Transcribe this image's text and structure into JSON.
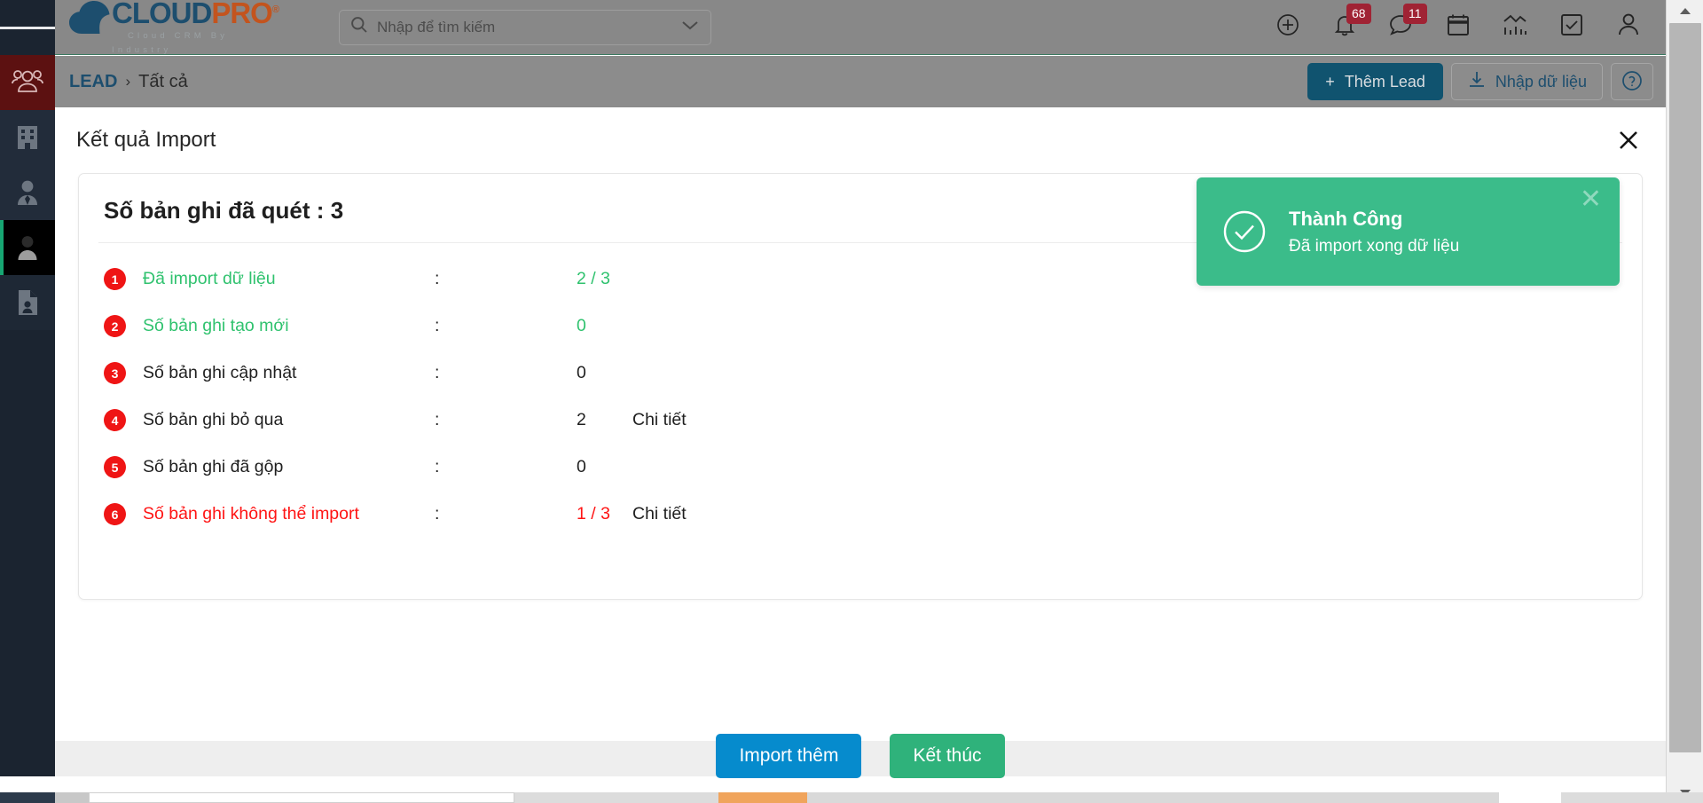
{
  "app": {
    "logo": {
      "cloud": "CLOUD",
      "pro": "PRO",
      "reg": "®",
      "tagline": "Cloud CRM By Industry"
    }
  },
  "search": {
    "placeholder": "Nhập để tìm kiếm",
    "value": ""
  },
  "topbar": {
    "icons": [
      {
        "name": "add-circle-icon",
        "badge": ""
      },
      {
        "name": "bell-icon",
        "badge": "68"
      },
      {
        "name": "chat-icon",
        "badge": "11"
      },
      {
        "name": "calendar-icon",
        "badge": ""
      },
      {
        "name": "analytics-icon",
        "badge": ""
      },
      {
        "name": "task-check-icon",
        "badge": ""
      },
      {
        "name": "user-icon",
        "badge": ""
      }
    ]
  },
  "breadcrumb": {
    "root": "LEAD",
    "separator": "›",
    "current": "Tất cả"
  },
  "subactions": {
    "add_lead": "Thêm Lead",
    "add_lead_plus": "+",
    "import_data": "Nhập dữ liệu",
    "help": "?"
  },
  "sidebar": {
    "items": [
      {
        "name": "sidebar-item-group",
        "label": "group-people-icon"
      },
      {
        "name": "sidebar-item-company",
        "label": "building-icon"
      },
      {
        "name": "sidebar-item-contact",
        "label": "person-tie-icon"
      },
      {
        "name": "sidebar-item-lead",
        "label": "person-icon"
      },
      {
        "name": "sidebar-item-document",
        "label": "document-person-icon"
      }
    ]
  },
  "modal": {
    "title": "Kết quả Import",
    "close": "✕",
    "card": {
      "heading_label": "Số bản ghi đã quét",
      "heading_colon": ":",
      "heading_value": "3",
      "rows": [
        {
          "num": "1",
          "label": "Đã import dữ liệu",
          "colon": ":",
          "value": "2 / 3",
          "detail": "",
          "color": "green"
        },
        {
          "num": "2",
          "label": "Số bản ghi tạo mới",
          "colon": ":",
          "value": "0",
          "detail": "",
          "color": "green"
        },
        {
          "num": "3",
          "label": "Số bản ghi cập nhật",
          "colon": ":",
          "value": "0",
          "detail": "",
          "color": "dark"
        },
        {
          "num": "4",
          "label": "Số bản ghi bỏ qua",
          "colon": ":",
          "value": "2",
          "detail": "Chi tiết",
          "color": "dark"
        },
        {
          "num": "5",
          "label": "Số bản ghi đã gộp",
          "colon": ":",
          "value": "0",
          "detail": "",
          "color": "dark"
        },
        {
          "num": "6",
          "label": "Số bản ghi không thể import",
          "colon": ":",
          "value": "1 / 3",
          "detail": "Chi tiết",
          "color": "red"
        }
      ]
    }
  },
  "footer": {
    "import_more": "Import thêm",
    "finish": "Kết thúc"
  },
  "toast": {
    "title": "Thành Công",
    "message": "Đã import xong dữ liệu",
    "close": "✕",
    "icon": "check-circle-icon"
  },
  "colors": {
    "brand_blue": "#1d4e6e",
    "brand_orange": "#c3541e",
    "success_green": "#3bbc8a",
    "value_green": "#2fc26e",
    "danger_red": "#ff1414",
    "badge_red": "#a02334",
    "number_red": "#ef1515",
    "button_blue": "#068bcd",
    "button_green": "#2fb27b",
    "rail_dark": "#1b2430"
  }
}
